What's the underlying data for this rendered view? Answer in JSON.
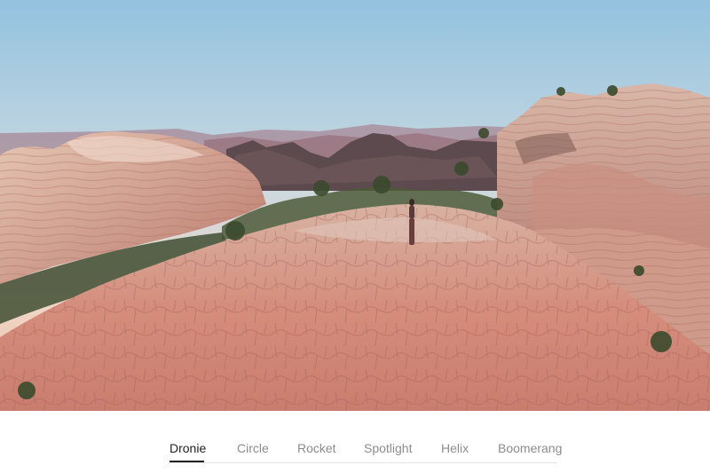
{
  "tabs": [
    {
      "label": "Dronie",
      "active": true
    },
    {
      "label": "Circle",
      "active": false
    },
    {
      "label": "Rocket",
      "active": false
    },
    {
      "label": "Spotlight",
      "active": false
    },
    {
      "label": "Helix",
      "active": false
    },
    {
      "label": "Boomerang",
      "active": false
    }
  ],
  "colors": {
    "active_tab": "#222222",
    "inactive_tab": "#8c8c8c",
    "divider": "#e3e3e3"
  }
}
